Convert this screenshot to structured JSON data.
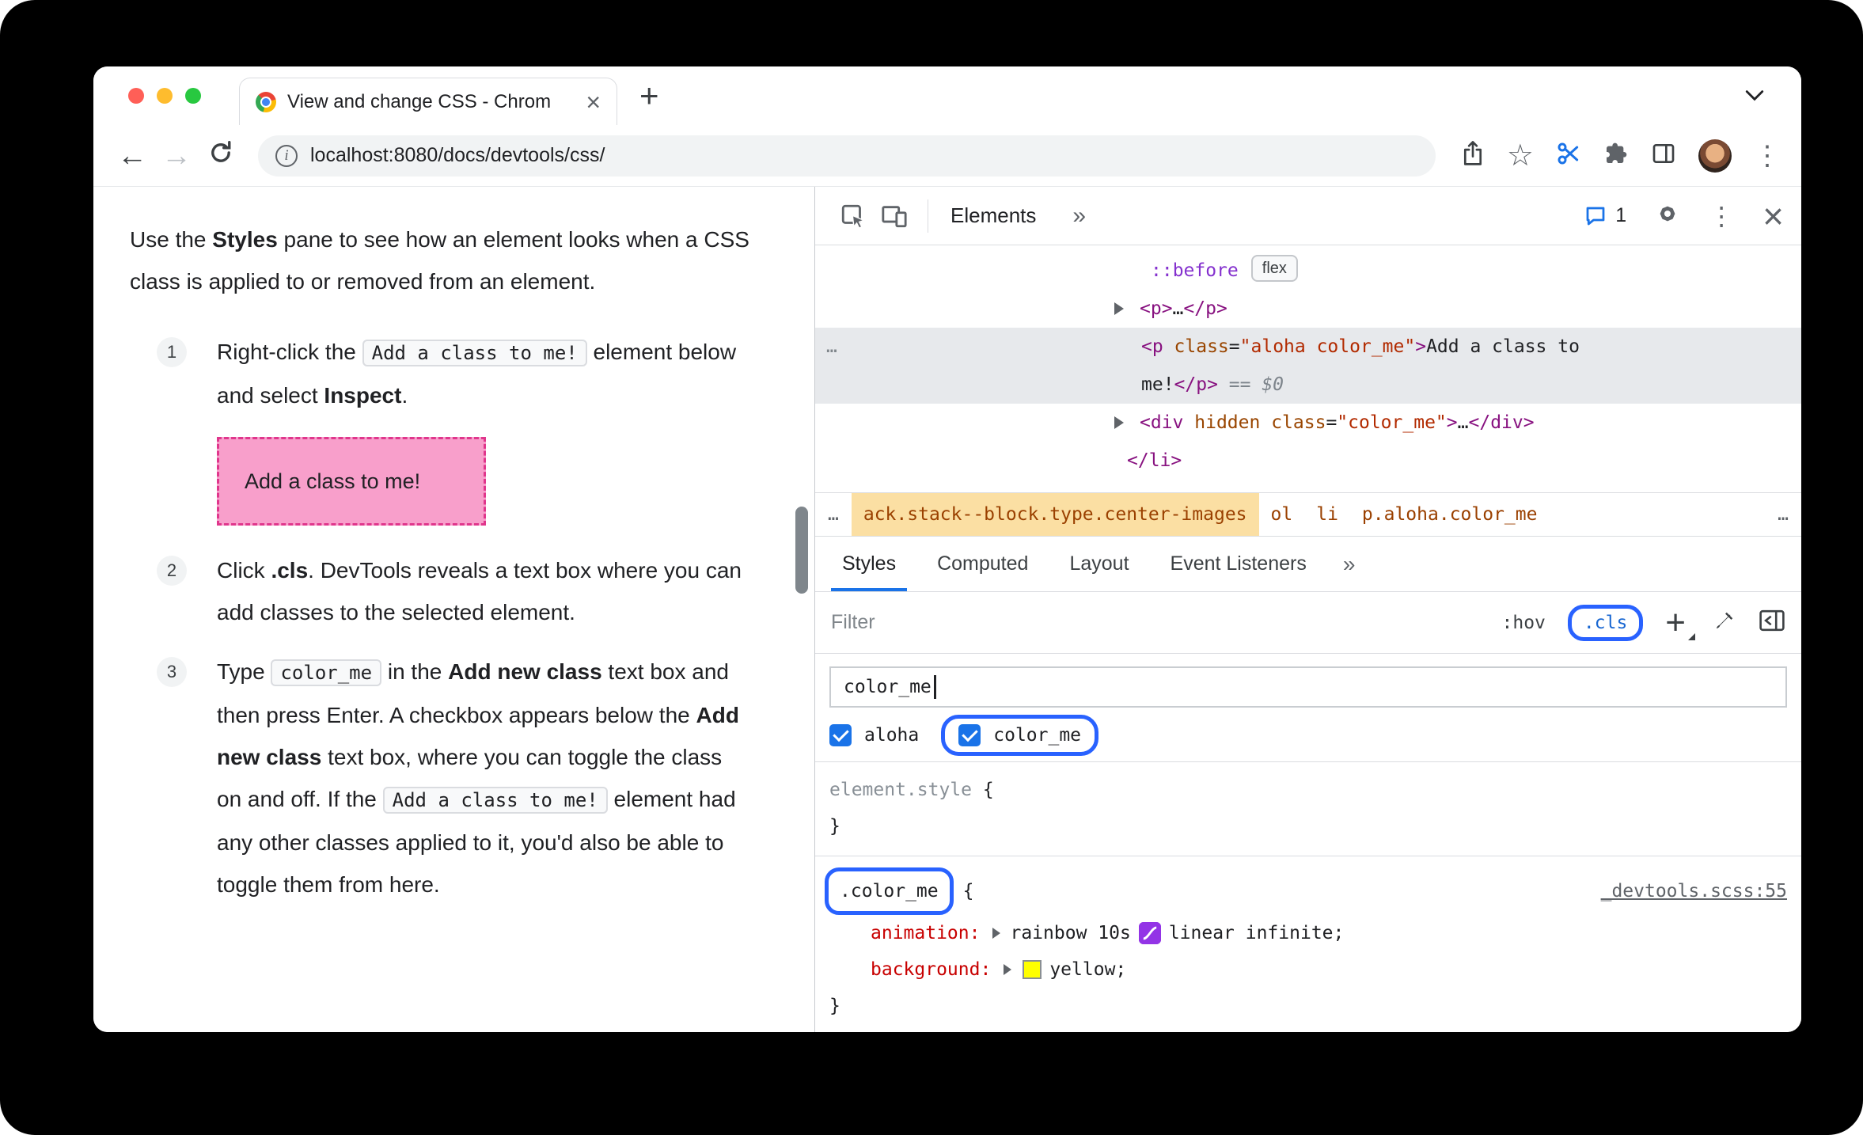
{
  "icons": {
    "back": "←",
    "forward": "→",
    "star": "☆",
    "kebab": "⋮",
    "tab_close": "×",
    "devtools_close": "×",
    "new_tab": "+",
    "info": "i"
  },
  "colors": {
    "callout_blue": "#2962ff",
    "checkbox_blue": "#1a73e8",
    "demo_pink": "#f89fcb",
    "swatch_yellow": "#ffff00"
  },
  "browser": {
    "tab_title": "View and change CSS - Chrom",
    "url": "localhost:8080/docs/devtools/css/"
  },
  "doc": {
    "intro": [
      {
        "t": "text",
        "v": "Use the "
      },
      {
        "t": "bold",
        "v": "Styles"
      },
      {
        "t": "text",
        "v": " pane to see how an element looks when a CSS class is applied to or removed from an element."
      }
    ],
    "steps": [
      {
        "num": "1",
        "segments": [
          {
            "t": "text",
            "v": "Right-click the "
          },
          {
            "t": "code",
            "v": "Add a class to me!"
          },
          {
            "t": "text",
            "v": " element below and select "
          },
          {
            "t": "bold",
            "v": "Inspect"
          },
          {
            "t": "text",
            "v": "."
          }
        ],
        "demo": "Add a class to me!"
      },
      {
        "num": "2",
        "segments": [
          {
            "t": "text",
            "v": "Click "
          },
          {
            "t": "bold",
            "v": ".cls"
          },
          {
            "t": "text",
            "v": ". DevTools reveals a text box where you can add classes to the selected element."
          }
        ]
      },
      {
        "num": "3",
        "segments": [
          {
            "t": "text",
            "v": "Type "
          },
          {
            "t": "code",
            "v": "color_me"
          },
          {
            "t": "text",
            "v": " in the "
          },
          {
            "t": "bold",
            "v": "Add new class"
          },
          {
            "t": "text",
            "v": " text box and then press Enter. A checkbox appears below the "
          },
          {
            "t": "bold",
            "v": "Add new class"
          },
          {
            "t": "text",
            "v": " text box, where you can toggle the class on and off. If the "
          },
          {
            "t": "code",
            "v": "Add a class to me!"
          },
          {
            "t": "text",
            "v": " element had any other classes applied to it, you'd also be able to toggle them from here."
          }
        ]
      }
    ]
  },
  "devtools": {
    "toolbar": {
      "panel": "Elements",
      "more": "»",
      "badge_count": "1"
    },
    "dom_lines": [
      {
        "pad": 424,
        "tokens": [
          {
            "c": "pseudo",
            "v": "::before"
          },
          {
            "c": "badge",
            "v": "flex"
          }
        ]
      },
      {
        "pad": 410,
        "arrow": true,
        "tokens": [
          {
            "c": "tag",
            "v": "<p>"
          },
          {
            "c": "plain",
            "v": "…"
          },
          {
            "c": "tag",
            "v": "</p>"
          }
        ]
      },
      {
        "pad": 412,
        "selected": true,
        "ellipsis": "…",
        "tokens": [
          {
            "c": "tag",
            "v": "<p "
          },
          {
            "c": "attr",
            "v": "class"
          },
          {
            "c": "plain",
            "v": "="
          },
          {
            "c": "value",
            "v": "\"aloha color_me\""
          },
          {
            "c": "tag",
            "v": ">"
          },
          {
            "c": "plain",
            "v": "Add a class to"
          }
        ]
      },
      {
        "pad": 412,
        "selected": true,
        "tokens": [
          {
            "c": "plain",
            "v": "me!"
          },
          {
            "c": "tag",
            "v": "</p>"
          },
          {
            "c": "eq",
            "v": " == "
          },
          {
            "c": "dollar",
            "v": "$0"
          }
        ]
      },
      {
        "pad": 410,
        "arrow": true,
        "tokens": [
          {
            "c": "tag",
            "v": "<div "
          },
          {
            "c": "attr",
            "v": "hidden"
          },
          {
            "c": "attr",
            "v": " class"
          },
          {
            "c": "plain",
            "v": "="
          },
          {
            "c": "value",
            "v": "\"color_me\""
          },
          {
            "c": "tag",
            "v": ">"
          },
          {
            "c": "plain",
            "v": "…"
          },
          {
            "c": "tag",
            "v": "</div>"
          }
        ]
      },
      {
        "pad": 394,
        "tokens": [
          {
            "c": "tag",
            "v": "</li>"
          }
        ]
      }
    ],
    "breadcrumbs": {
      "left_ellipsis": "…",
      "items": [
        {
          "label": "ack.stack--block.type.center-images",
          "highlight": true
        },
        {
          "label": "ol"
        },
        {
          "label": "li"
        },
        {
          "label": "p.aloha.color_me"
        }
      ],
      "right_ellipsis": "…"
    },
    "sidebar_tabs": {
      "tabs": [
        "Styles",
        "Computed",
        "Layout",
        "Event Listeners"
      ],
      "active": "Styles",
      "more": "»"
    },
    "filter_bar": {
      "placeholder": "Filter",
      "hov": ":hov",
      "cls": ".cls"
    },
    "class_editor": {
      "input_value": "color_me",
      "classes": [
        {
          "label": "aloha",
          "checked": true
        },
        {
          "label": "color_me",
          "checked": true,
          "callout": true
        }
      ]
    },
    "styles": {
      "element_style": {
        "selector": "element.style",
        "open": "{",
        "close": "}"
      },
      "rule": {
        "selector": ".color_me",
        "open": "{",
        "close": "}",
        "source": "_devtools.scss:55",
        "declarations": [
          {
            "name": "animation:",
            "expand": true,
            "value_pre": "rainbow 10s",
            "has_easing_icon": true,
            "value_post": "linear infinite;"
          },
          {
            "name": "background:",
            "expand": true,
            "swatch": "#ffff00",
            "value": "yellow;"
          }
        ]
      }
    }
  }
}
